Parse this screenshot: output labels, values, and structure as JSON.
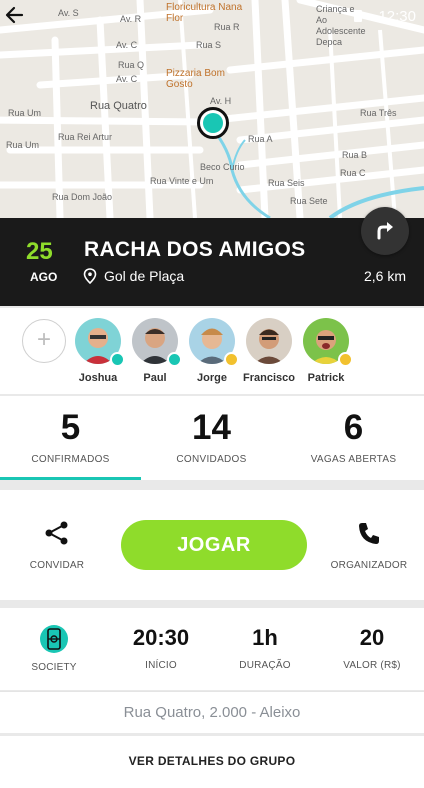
{
  "status_bar": {
    "time": "12:30"
  },
  "map": {
    "street_labels": [
      "Av. S",
      "Av. R",
      "Av. C",
      "Rua Q",
      "Av. C",
      "Rua S",
      "Av. H",
      "Rua Quatro",
      "Rua Um",
      "Rua Rei Artur",
      "Rua Dom João",
      "Rua Vinte e Um",
      "Rua Um",
      "Beco Curio",
      "Rua Seis",
      "Rua A",
      "Rua B",
      "Rua C",
      "Rua Três",
      "Rua Sete",
      "Rua R"
    ],
    "pois": [
      "Floricultura Nana Flor",
      "Pizzaria Bom Gosto",
      "Criança e Ao Adolescente Depca"
    ]
  },
  "event": {
    "day": "25",
    "month": "AGO",
    "title": "RACHA DOS AMIGOS",
    "place": "Gol de Plaça",
    "distance": "2,6 km"
  },
  "players": {
    "add_label": "+",
    "list": [
      {
        "name": "Joshua",
        "badge": "crown"
      },
      {
        "name": "Paul",
        "badge": "crown"
      },
      {
        "name": "Jorge",
        "badge": "coin"
      },
      {
        "name": "Francisco",
        "badge": "none"
      },
      {
        "name": "Patrick",
        "badge": "coin"
      }
    ]
  },
  "stats": {
    "confirmed": {
      "value": "5",
      "label": "CONFIRMADOS"
    },
    "invited": {
      "value": "14",
      "label": "CONVIDADOS"
    },
    "open": {
      "value": "6",
      "label": "VAGAS ABERTAS"
    },
    "active_tab": "CONFIRMADOS"
  },
  "actions": {
    "invite_label": "CONVIDAR",
    "play_label": "JOGAR",
    "organizer_label": "ORGANIZADOR"
  },
  "info": {
    "type_label": "SOCIETY",
    "start": {
      "value": "20:30",
      "label": "INÍCIO"
    },
    "duration": {
      "value": "1h",
      "label": "DURAÇÃO"
    },
    "price": {
      "value": "20",
      "label": "VALOR (R$)"
    }
  },
  "address": "Rua Quatro, 2.000 - Aleixo",
  "details_link": "VER DETALHES DO GRUPO",
  "colors": {
    "accent_green": "#8fdc2b",
    "accent_teal": "#19c6b4",
    "dark_bar": "#1a1a1a"
  }
}
